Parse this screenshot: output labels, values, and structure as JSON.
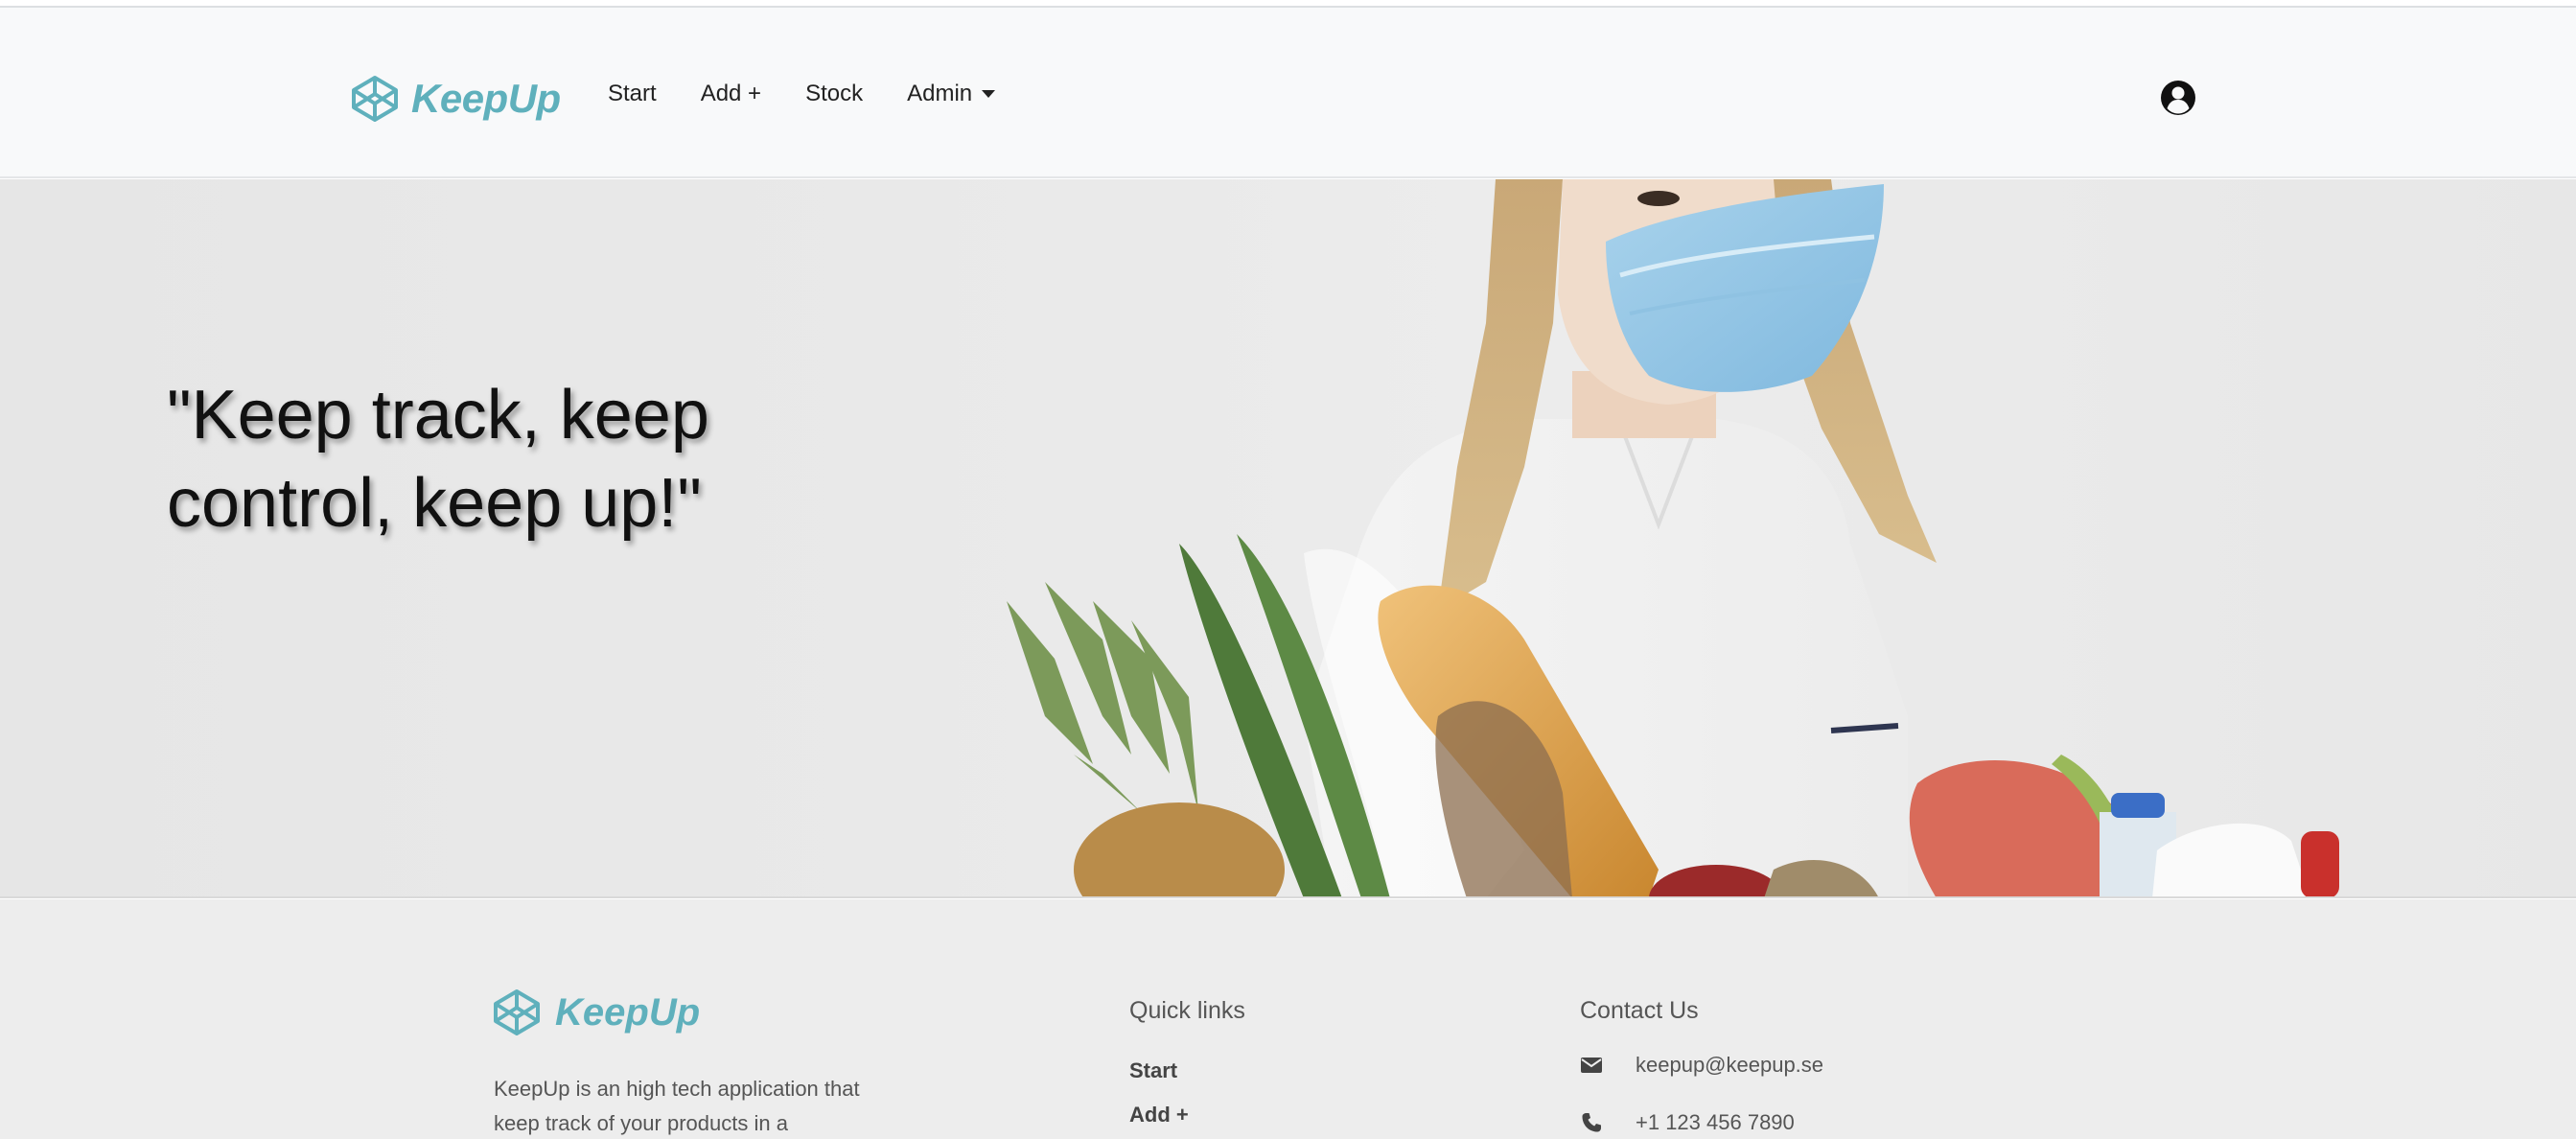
{
  "colors": {
    "brand": "#5fb0bc",
    "navbar_bg": "#f8f9fa",
    "footer_bg": "#ededed"
  },
  "navbar": {
    "brand": "KeepUp",
    "links": [
      {
        "label": "Start"
      },
      {
        "label": "Add +"
      },
      {
        "label": "Stock"
      },
      {
        "label": "Admin"
      }
    ],
    "user_icon": "user-circle-icon"
  },
  "hero": {
    "quote": "\"Keep track, keep control, keep up!\""
  },
  "footer": {
    "brand": "KeepUp",
    "description": "KeepUp is an high tech application that keep track of your products in a",
    "quick_links": {
      "heading": "Quick links",
      "items": [
        {
          "label": "Start"
        },
        {
          "label": "Add +"
        }
      ]
    },
    "contact": {
      "heading": "Contact Us",
      "email": "keepup@keepup.se",
      "phone": "+1 123 456 7890"
    }
  }
}
